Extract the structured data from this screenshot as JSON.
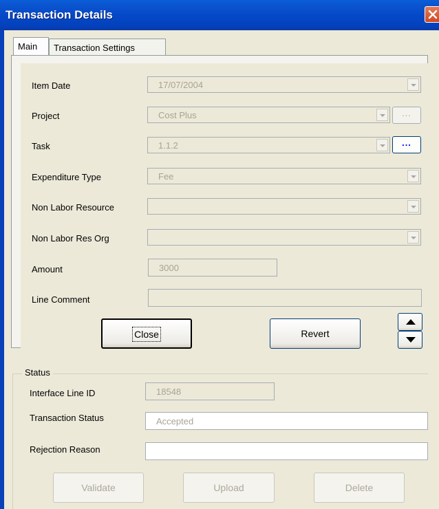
{
  "window": {
    "title": "Transaction Details"
  },
  "tabs": {
    "main": "Main",
    "settings": "Transaction Settings"
  },
  "fields": {
    "item_date": {
      "label": "Item Date",
      "value": "17/07/2004"
    },
    "project": {
      "label": "Project",
      "value": "Cost Plus",
      "lookup": "..."
    },
    "task": {
      "label": "Task",
      "value": "1.1.2",
      "lookup": "..."
    },
    "expenditure_type": {
      "label": "Expenditure Type",
      "value": "Fee"
    },
    "non_labor_resource": {
      "label": "Non Labor Resource",
      "value": ""
    },
    "non_labor_res_org": {
      "label": "Non Labor Res Org",
      "value": ""
    },
    "amount": {
      "label": "Amount",
      "value": "3000"
    },
    "line_comment": {
      "label": "Line Comment",
      "value": ""
    }
  },
  "buttons": {
    "close": "Close",
    "revert": "Revert",
    "validate": "Validate",
    "upload": "Upload",
    "delete": "Delete"
  },
  "status": {
    "legend": "Status",
    "interface_line_id": {
      "label": "Interface Line ID",
      "value": "18548"
    },
    "transaction_status": {
      "label": "Transaction Status",
      "value": "Accepted"
    },
    "rejection_reason": {
      "label": "Rejection Reason",
      "value": ""
    }
  },
  "icons": {
    "window_close": "close-icon",
    "move_up": "arrow-up-icon",
    "move_down": "arrow-down-icon"
  }
}
